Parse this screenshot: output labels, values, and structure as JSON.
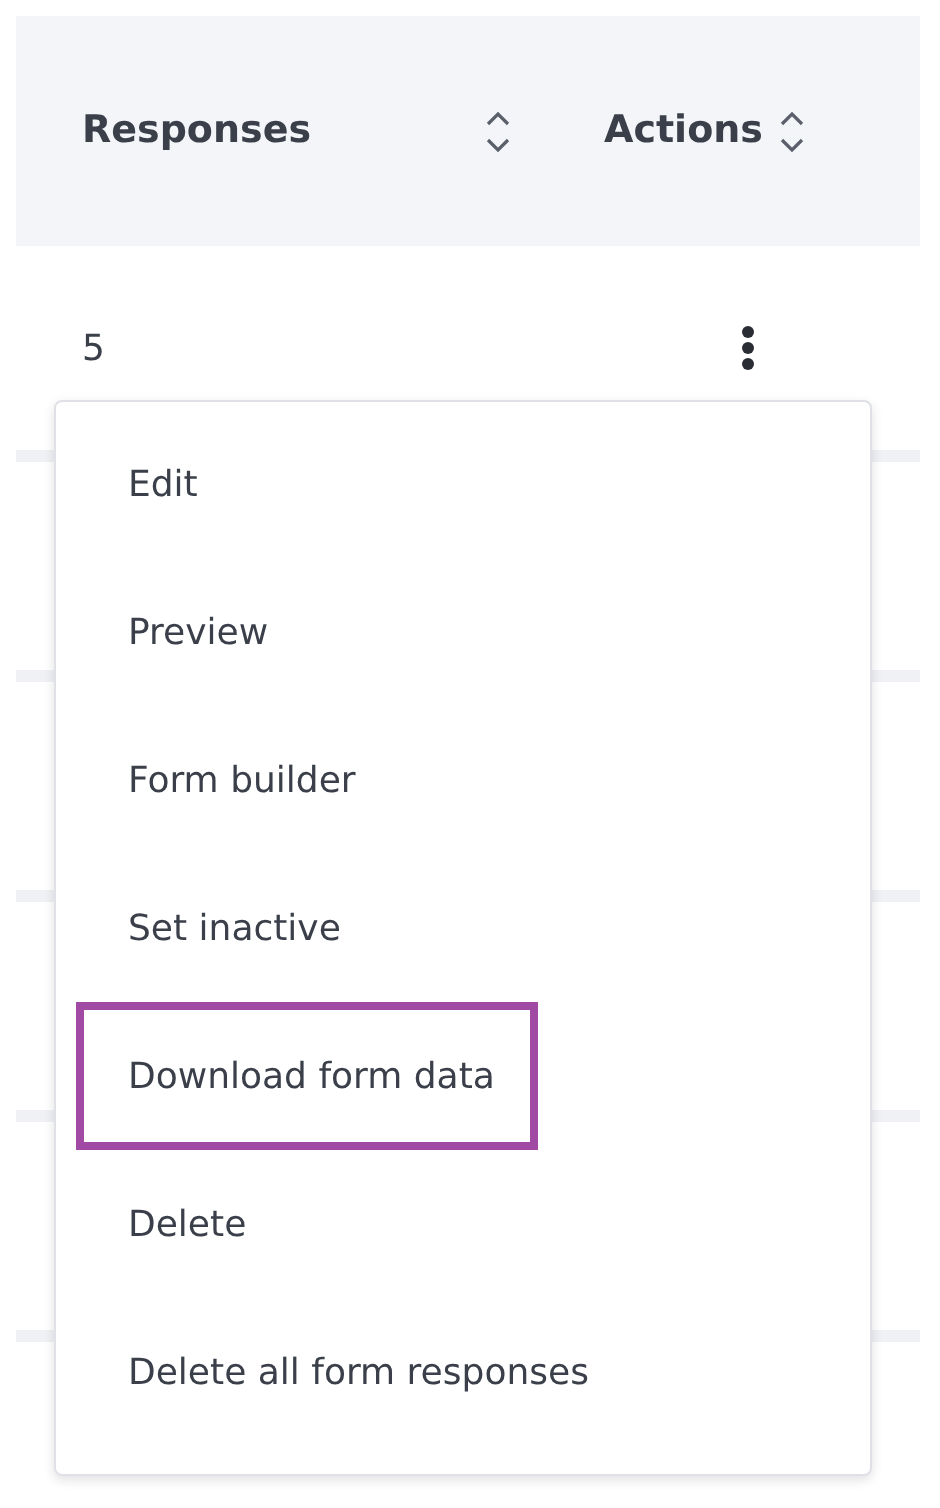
{
  "table": {
    "columns": [
      {
        "label": "Responses",
        "sortable": true
      },
      {
        "label": "Actions",
        "sortable": true
      }
    ],
    "rows": [
      {
        "responses": "5"
      }
    ]
  },
  "actions_menu": {
    "items": [
      {
        "label": "Edit",
        "highlighted": false
      },
      {
        "label": "Preview",
        "highlighted": false
      },
      {
        "label": "Form builder",
        "highlighted": false
      },
      {
        "label": "Set inactive",
        "highlighted": false
      },
      {
        "label": "Download form data",
        "highlighted": true
      },
      {
        "label": "Delete",
        "highlighted": false
      },
      {
        "label": "Delete all form responses",
        "highlighted": false
      }
    ]
  }
}
